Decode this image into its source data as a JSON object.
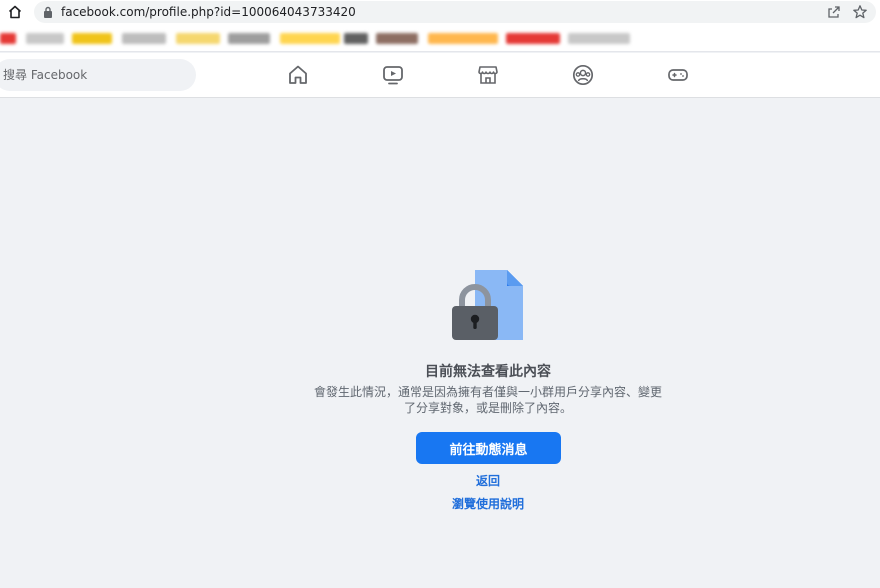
{
  "browser": {
    "url": "facebook.com/profile.php?id=100064043733420",
    "bookmark_colors": [
      "#e53935",
      "#c8c8c8",
      "#f0c419",
      "#bdbdbd",
      "#f5d76e",
      "#9e9e9e",
      "#ffd54f",
      "#616161",
      "#8d6e63",
      "#ffb74d"
    ]
  },
  "facebook": {
    "search_placeholder": "搜尋 Facebook",
    "tabs": [
      {
        "name": "home-icon"
      },
      {
        "name": "watch-icon"
      },
      {
        "name": "marketplace-icon"
      },
      {
        "name": "groups-icon"
      },
      {
        "name": "gaming-icon"
      }
    ]
  },
  "content": {
    "title": "目前無法查看此內容",
    "body": "會發生此情況，通常是因為擁有者僅與一小群用戶分享內容、變更了分享對象，或是刪除了內容。",
    "primary_button": "前往動態消息",
    "back_link": "返回",
    "help_link": "瀏覽使用說明",
    "colors": {
      "accent": "#1877f2",
      "link": "#216fdb",
      "page_bg": "#f0f2f5"
    }
  }
}
